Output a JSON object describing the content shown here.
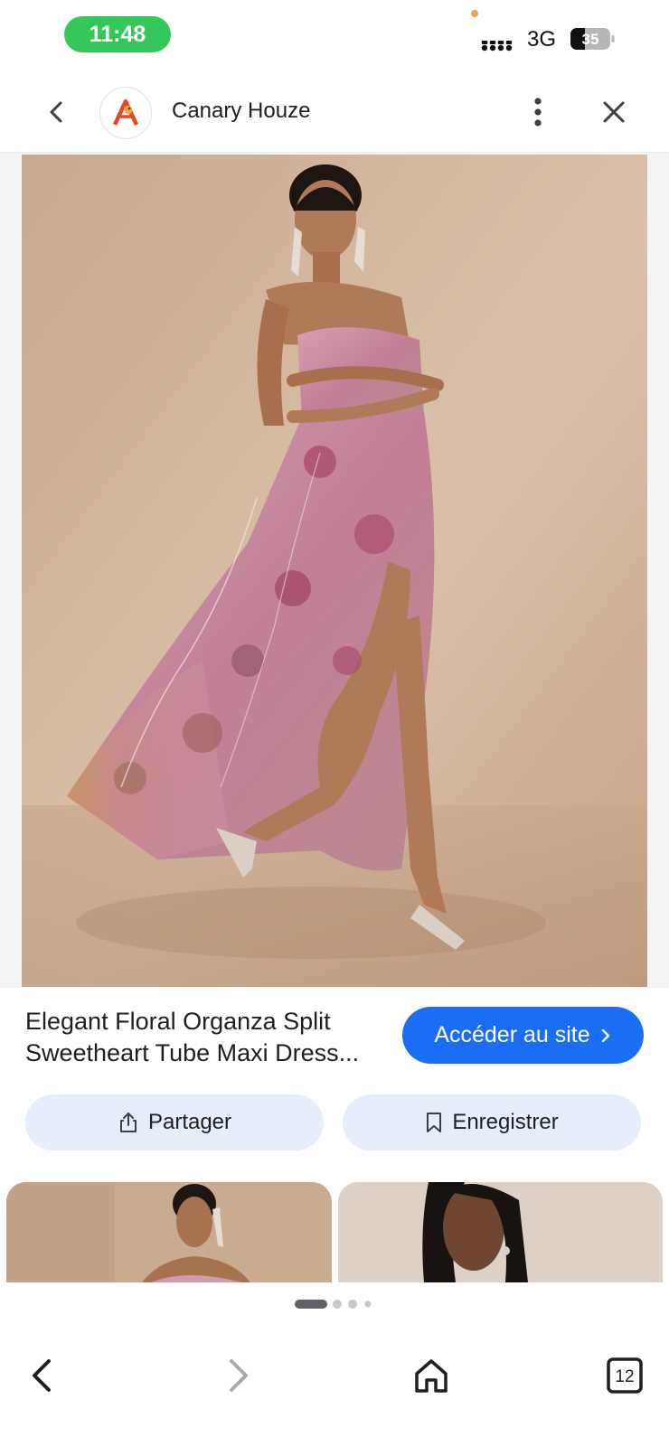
{
  "status_bar": {
    "time": "11:48",
    "network": "3G",
    "battery": "35"
  },
  "header": {
    "site_name": "Canary Houze",
    "back_icon": "chevron-left-icon",
    "menu_icon": "more-vert-icon",
    "close_icon": "close-icon"
  },
  "product": {
    "title_line1": "Elegant Floral Organza Split",
    "title_line2": "Sweetheart Tube Maxi Dress...",
    "visit_button": "Accéder au site",
    "share_button": "Partager",
    "save_button": "Enregistrer"
  },
  "pager": {
    "total": 4,
    "active": 1
  },
  "bottom_nav": {
    "tab_count": "12"
  },
  "colors": {
    "accent": "#1b6ef3",
    "button_fill": "#e7eefb",
    "status_pill": "#35c759",
    "dress_pink": "#c98aa0",
    "backdrop": "#d2b49c"
  }
}
